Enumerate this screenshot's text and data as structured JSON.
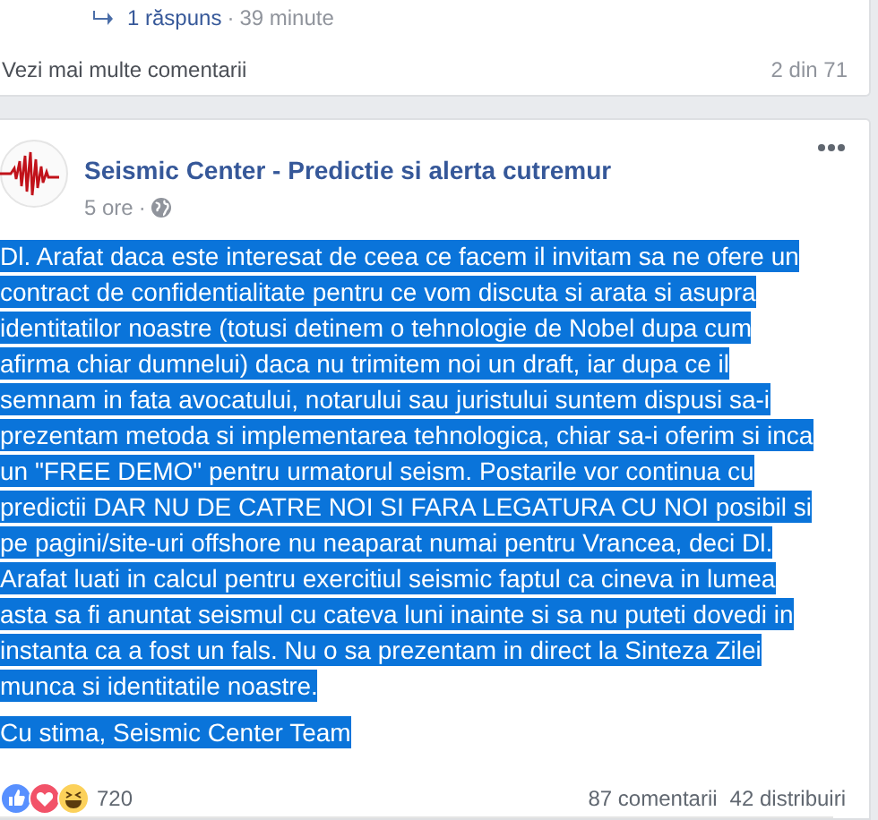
{
  "previous_post": {
    "reply_link": "1 răspuns",
    "reply_separator": "·",
    "reply_time": "39 minute",
    "more_comments_link": "Vezi mai multe comentarii",
    "comment_count": "2 din 71"
  },
  "post": {
    "page_name": "Seismic Center - Predictie si alerta cutremur",
    "time": "5 ore",
    "separator": "·",
    "selected": true,
    "paragraphs": [
      "Dl. Arafat daca este interesat de ceea ce facem il invitam sa ne ofere un contract de confidentialitate pentru ce vom discuta si arata si asupra identitatilor noastre (totusi detinem o tehnologie de Nobel dupa cum afirma chiar dumnelui) daca nu trimitem noi un draft, iar dupa ce il semnam in fata avocatului, notarului sau juristului suntem dispusi sa-i prezentam metoda si implementarea tehnologica, chiar sa-i oferim si inca un \"FREE DEMO\" pentru urmatorul seism. Postarile vor continua cu predictii DAR NU DE CATRE NOI SI FARA LEGATURA CU NOI posibil si pe pagini/site-uri offshore nu neaparat numai pentru Vrancea, deci Dl. Arafat luati in calcul pentru exercitiul seismic faptul ca cineva in lumea asta sa fi anuntat seismul cu cateva luni inainte si sa nu puteti dovedi in instanta ca a fost un fals. Nu o sa prezentam in direct la Sinteza Zilei munca si identitatile noastre.",
      "Cu stima, Seismic Center Team"
    ],
    "reactions": [
      {
        "kind": "like"
      },
      {
        "kind": "love"
      },
      {
        "kind": "haha"
      }
    ],
    "reaction_count": "720",
    "comments": "87 comentarii",
    "shares": "42 distribuiri"
  }
}
